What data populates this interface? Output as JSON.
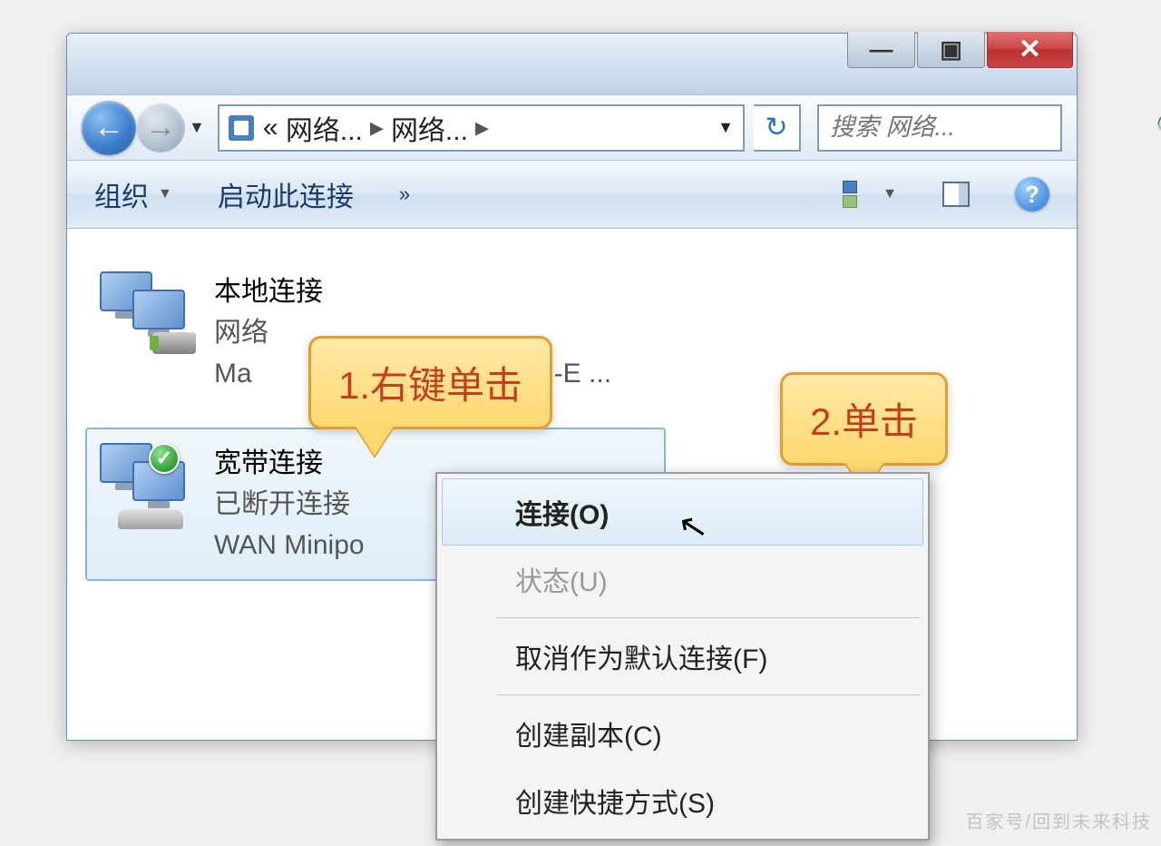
{
  "breadcrumb": {
    "part1": "网络...",
    "part2": "网络..."
  },
  "search": {
    "placeholder": "搜索 网络..."
  },
  "toolbar": {
    "organize": "组织",
    "start_conn": "启动此连接"
  },
  "connections": [
    {
      "title": "本地连接",
      "sub1": "网络",
      "sub2_prefix": "Ma",
      "sub2_suffix": "I-E ..."
    },
    {
      "title": "宽带连接",
      "sub1": "已断开连接",
      "sub2": "WAN Minipo"
    }
  ],
  "callouts": {
    "c1": "1.右键单击",
    "c2": "2.单击"
  },
  "context_menu": {
    "connect": "连接(O)",
    "status": "状态(U)",
    "unset_default": "取消作为默认连接(F)",
    "copy": "创建副本(C)",
    "shortcut": "创建快捷方式(S)"
  },
  "watermark": "百家号/回到未来科技"
}
